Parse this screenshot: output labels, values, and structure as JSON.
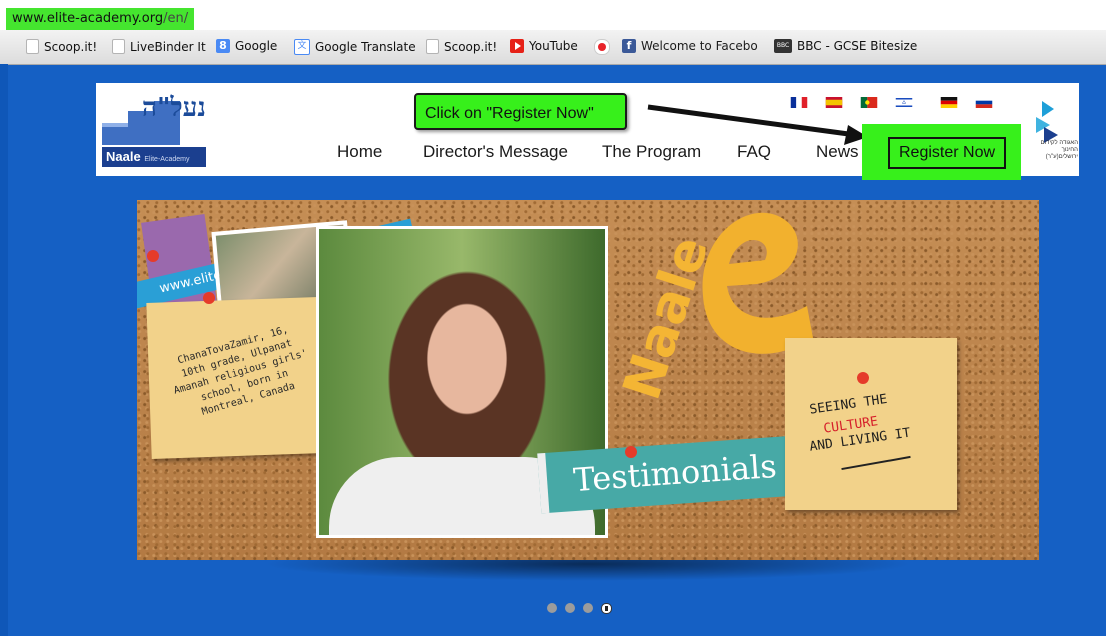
{
  "browser": {
    "url_domain": "www.elite-academy.org",
    "url_path": "/en/",
    "bookmarks": [
      {
        "label": "Scoop.it!",
        "icon": "page-icon"
      },
      {
        "label": "LiveBinder It",
        "icon": "page-icon"
      },
      {
        "label": "Google",
        "icon": "google-icon"
      },
      {
        "label": "Google Translate",
        "icon": "google-translate-icon"
      },
      {
        "label": "Scoop.it!",
        "icon": "page-icon"
      },
      {
        "label": "YouTube",
        "icon": "youtube-icon"
      },
      {
        "label": "",
        "icon": "record-icon"
      },
      {
        "label": "Welcome to Facebo",
        "icon": "facebook-icon"
      },
      {
        "label": "BBC - GCSE Bitesize",
        "icon": "bbc-icon"
      }
    ]
  },
  "header": {
    "logo": {
      "hebrew": "נעל\"ה",
      "name": "Naale",
      "sub": "Elite-Academy"
    },
    "callout": "Click on \"Register Now\"",
    "nav": [
      "Home",
      "Director's Message",
      "The Program",
      "FAQ",
      "News",
      "Register Now"
    ],
    "flags": [
      "france-flag",
      "spain-flag",
      "portugal-flag",
      "israel-flag",
      "germany-flag",
      "russia-flag"
    ],
    "org_text": "האגודה לקידום החינוך ירושלים(ע\"ר)"
  },
  "slide": {
    "ribbon": "www.elite-academy.org",
    "note_left": "ChanaTovaZamir, 16, 10th grade, Ulpanat Amanah religious girls' school, born in Montreal, Canada",
    "brand_word": "Naale",
    "banner": "Testimonials",
    "note_right": {
      "line1": "SEEING THE",
      "line2": "CULTURE",
      "line3": "AND LIVING IT"
    }
  },
  "carousel": {
    "count": 4,
    "active_index": 3
  },
  "colors": {
    "highlight": "#37f01b",
    "page_bg": "#1560c4",
    "logo_blue": "#1b3f8f",
    "ribbon": "#2a9fd6",
    "banner": "#47a9a6"
  }
}
